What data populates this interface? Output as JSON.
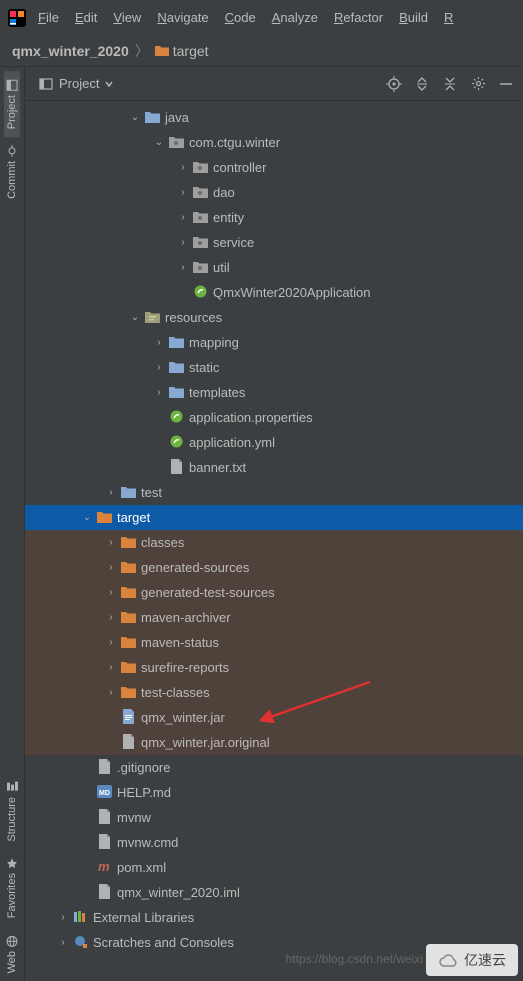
{
  "menu": {
    "items": [
      "File",
      "Edit",
      "View",
      "Navigate",
      "Code",
      "Analyze",
      "Refactor",
      "Build",
      "R"
    ]
  },
  "breadcrumb": {
    "project": "qmx_winter_2020",
    "folder": "target"
  },
  "panel": {
    "title": "Project"
  },
  "left_tabs": [
    "Project",
    "Commit",
    "Structure",
    "Favorites",
    "Web"
  ],
  "tree": [
    {
      "indent": 3,
      "arrow": "down",
      "icon": "folder-blue",
      "label": "java"
    },
    {
      "indent": 4,
      "arrow": "down",
      "icon": "folder-pkg",
      "label": "com.ctgu.winter"
    },
    {
      "indent": 5,
      "arrow": "right",
      "icon": "folder-pkg",
      "label": "controller"
    },
    {
      "indent": 5,
      "arrow": "right",
      "icon": "folder-pkg",
      "label": "dao"
    },
    {
      "indent": 5,
      "arrow": "right",
      "icon": "folder-pkg",
      "label": "entity"
    },
    {
      "indent": 5,
      "arrow": "right",
      "icon": "folder-pkg",
      "label": "service"
    },
    {
      "indent": 5,
      "arrow": "right",
      "icon": "folder-pkg",
      "label": "util"
    },
    {
      "indent": 5,
      "arrow": "none",
      "icon": "file-spring",
      "label": "QmxWinter2020Application"
    },
    {
      "indent": 3,
      "arrow": "down",
      "icon": "folder-res",
      "label": "resources"
    },
    {
      "indent": 4,
      "arrow": "right",
      "icon": "folder-blue",
      "label": "mapping"
    },
    {
      "indent": 4,
      "arrow": "right",
      "icon": "folder-blue",
      "label": "static"
    },
    {
      "indent": 4,
      "arrow": "right",
      "icon": "folder-blue",
      "label": "templates"
    },
    {
      "indent": 4,
      "arrow": "none",
      "icon": "file-spring",
      "label": "application.properties"
    },
    {
      "indent": 4,
      "arrow": "none",
      "icon": "file-spring",
      "label": "application.yml"
    },
    {
      "indent": 4,
      "arrow": "none",
      "icon": "file-generic",
      "label": "banner.txt"
    },
    {
      "indent": 2,
      "arrow": "right",
      "icon": "folder-blue",
      "label": "test"
    },
    {
      "indent": 1,
      "arrow": "down",
      "icon": "folder-orange",
      "label": "target",
      "selected": true
    },
    {
      "indent": 2,
      "arrow": "right",
      "icon": "folder-orange",
      "label": "classes",
      "hl": true
    },
    {
      "indent": 2,
      "arrow": "right",
      "icon": "folder-orange",
      "label": "generated-sources",
      "hl": true
    },
    {
      "indent": 2,
      "arrow": "right",
      "icon": "folder-orange",
      "label": "generated-test-sources",
      "hl": true
    },
    {
      "indent": 2,
      "arrow": "right",
      "icon": "folder-orange",
      "label": "maven-archiver",
      "hl": true
    },
    {
      "indent": 2,
      "arrow": "right",
      "icon": "folder-orange",
      "label": "maven-status",
      "hl": true
    },
    {
      "indent": 2,
      "arrow": "right",
      "icon": "folder-orange",
      "label": "surefire-reports",
      "hl": true
    },
    {
      "indent": 2,
      "arrow": "right",
      "icon": "folder-orange",
      "label": "test-classes",
      "hl": true
    },
    {
      "indent": 2,
      "arrow": "none",
      "icon": "file-jar",
      "label": "qmx_winter.jar",
      "hl": true,
      "pointed": true
    },
    {
      "indent": 2,
      "arrow": "none",
      "icon": "file-generic",
      "label": "qmx_winter.jar.original",
      "hl": true
    },
    {
      "indent": 1,
      "arrow": "none",
      "icon": "file-generic",
      "label": ".gitignore"
    },
    {
      "indent": 1,
      "arrow": "none",
      "icon": "file-md",
      "label": "HELP.md"
    },
    {
      "indent": 1,
      "arrow": "none",
      "icon": "file-generic",
      "label": "mvnw"
    },
    {
      "indent": 1,
      "arrow": "none",
      "icon": "file-generic",
      "label": "mvnw.cmd"
    },
    {
      "indent": 1,
      "arrow": "none",
      "icon": "file-maven",
      "label": "pom.xml"
    },
    {
      "indent": 1,
      "arrow": "none",
      "icon": "file-generic",
      "label": "qmx_winter_2020.iml"
    },
    {
      "indent": 0,
      "arrow": "right",
      "icon": "lib",
      "label": "External Libraries"
    },
    {
      "indent": 0,
      "arrow": "right",
      "icon": "scratch",
      "label": "Scratches and Consoles"
    }
  ],
  "watermark": "https://blog.csdn.net/weixi",
  "brand": "亿速云"
}
